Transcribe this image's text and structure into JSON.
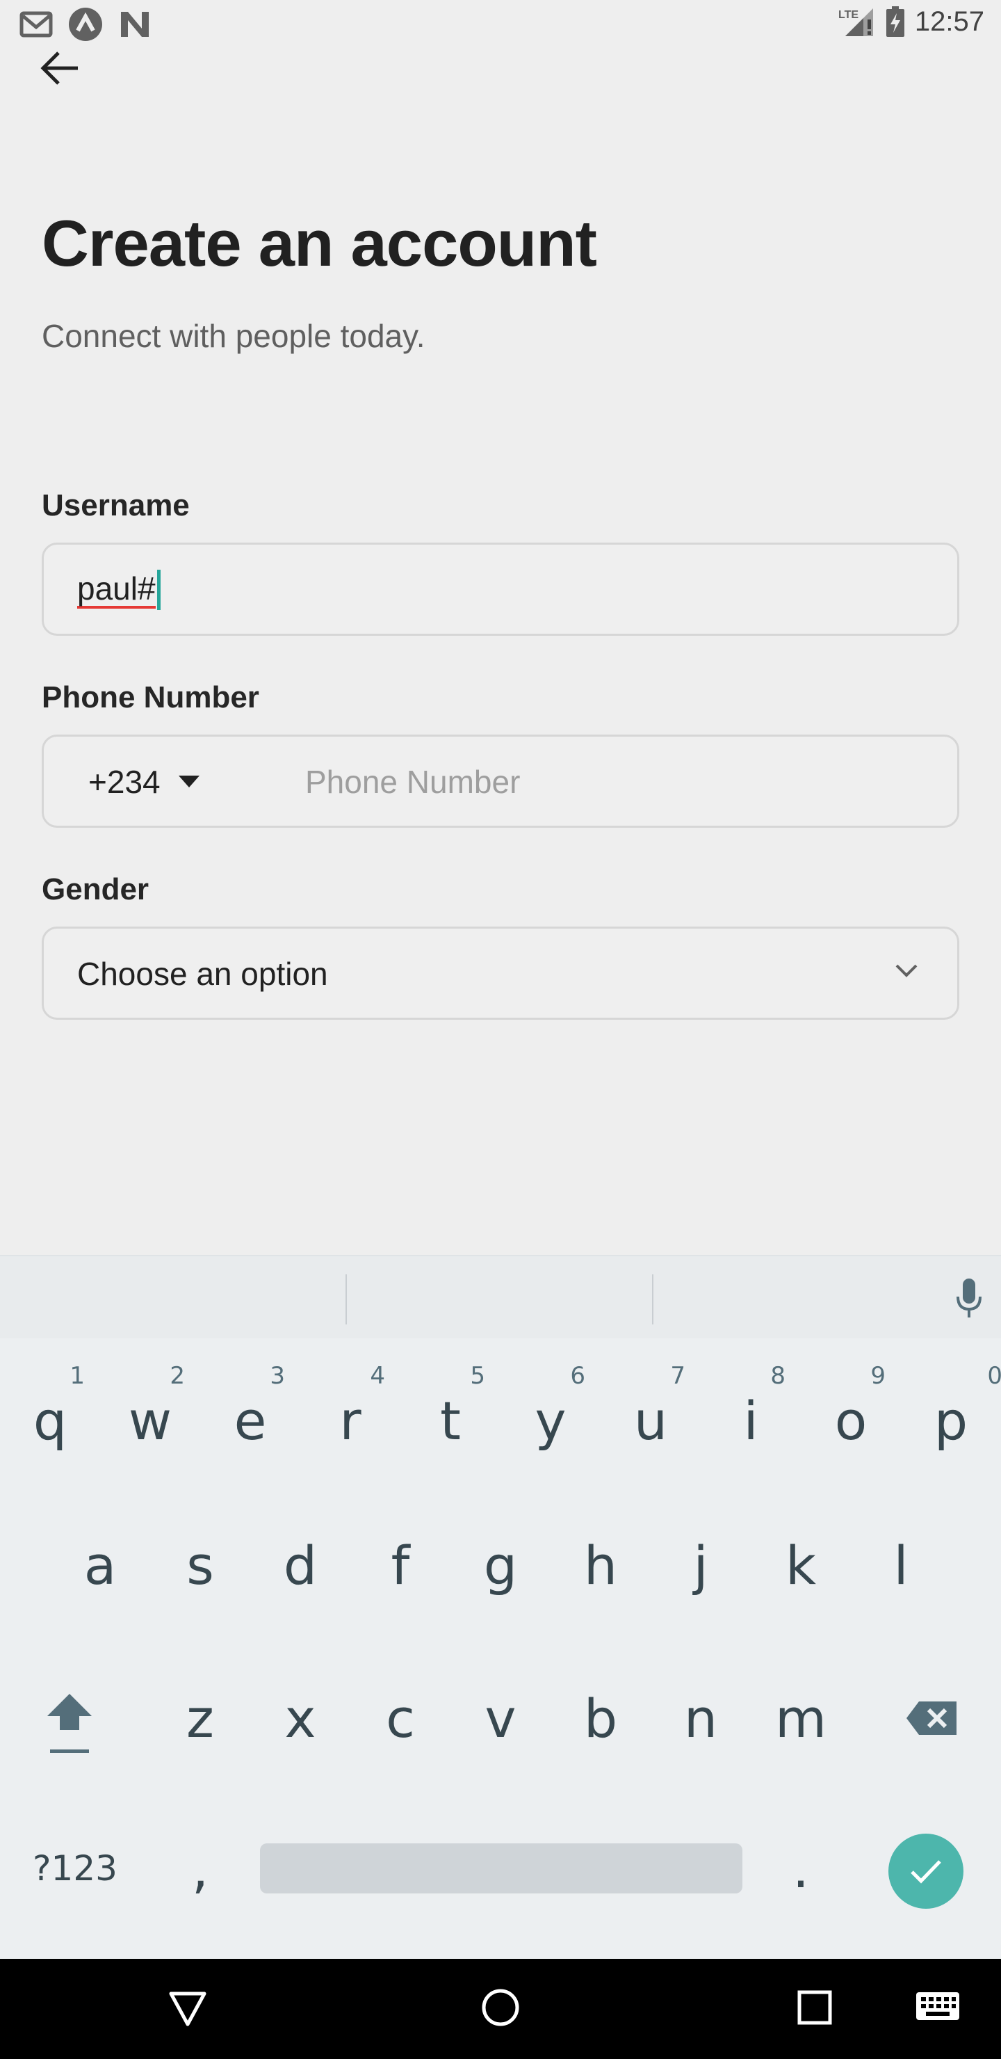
{
  "status_bar": {
    "time": "12:57",
    "network": "LTE",
    "left_icons": [
      "gmail-icon",
      "app-a-icon",
      "app-n-icon"
    ]
  },
  "header": {
    "back_icon": "arrow-left-icon",
    "title": "Create an account",
    "subtitle": "Connect with people today."
  },
  "form": {
    "username": {
      "label": "Username",
      "value": "paul#"
    },
    "phone": {
      "label": "Phone Number",
      "country_code": "+234",
      "placeholder": "Phone Number"
    },
    "gender": {
      "label": "Gender",
      "selected": "Choose an option"
    }
  },
  "keyboard": {
    "row1": [
      {
        "key": "q",
        "hint": "1"
      },
      {
        "key": "w",
        "hint": "2"
      },
      {
        "key": "e",
        "hint": "3"
      },
      {
        "key": "r",
        "hint": "4"
      },
      {
        "key": "t",
        "hint": "5"
      },
      {
        "key": "y",
        "hint": "6"
      },
      {
        "key": "u",
        "hint": "7"
      },
      {
        "key": "i",
        "hint": "8"
      },
      {
        "key": "o",
        "hint": "9"
      },
      {
        "key": "p",
        "hint": "0"
      }
    ],
    "row2": [
      "a",
      "s",
      "d",
      "f",
      "g",
      "h",
      "j",
      "k",
      "l"
    ],
    "row3": [
      "z",
      "x",
      "c",
      "v",
      "b",
      "n",
      "m"
    ],
    "symbols_label": "?123",
    "comma": ",",
    "period": ".",
    "accent_color": "#4db6ac"
  }
}
